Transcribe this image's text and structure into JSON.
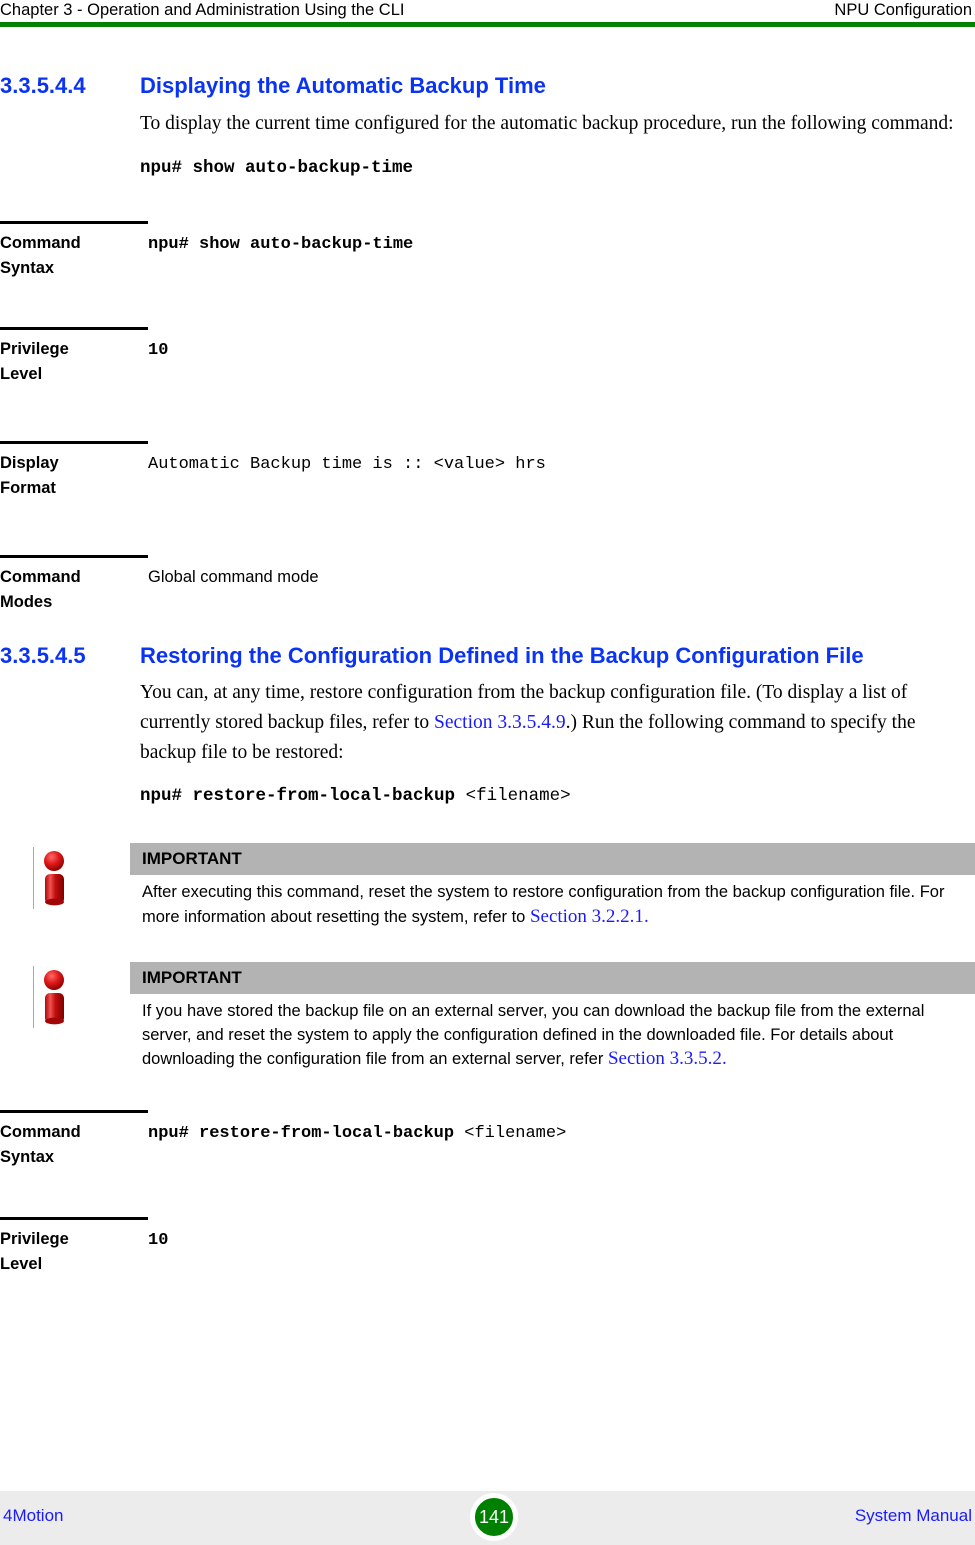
{
  "header": {
    "left": "Chapter 3 - Operation and Administration Using the CLI",
    "right": "NPU Configuration",
    "rule_color": "#008000"
  },
  "sections": [
    {
      "number": "3.3.5.4.4",
      "title": "Displaying the Automatic Backup Time",
      "paragraph": "To display the current time configured for the automatic backup procedure, run the following command:",
      "command": "npu# show auto-backup-time",
      "command_arg": ""
    },
    {
      "number": "3.3.5.4.5",
      "title": "Restoring the Configuration Defined in the Backup Configuration File",
      "paragraph_part1": "You can, at any time, restore configuration from the backup configuration file. (To display a list of currently stored backup files, refer to ",
      "paragraph_xref": "Section 3.3.5.4.9",
      "paragraph_part2": ".) Run the following command to specify the backup file to be restored:",
      "command": "npu# restore-from-local-backup",
      "command_arg": "<filename>"
    }
  ],
  "table_one": {
    "rows": [
      {
        "label_line1": "Command",
        "label_line2": "Syntax",
        "value": "npu# show auto-backup-time",
        "value_style": "mono-bold"
      },
      {
        "label_line1": "Privilege",
        "label_line2": "Level",
        "value": "10",
        "value_style": "mono-bold"
      },
      {
        "label_line1": "Display",
        "label_line2": "Format",
        "value": "Automatic Backup time is  :: <value> hrs",
        "value_style": "mono"
      },
      {
        "label_line1": "Command",
        "label_line2": "Modes",
        "value": "Global command mode",
        "value_style": "sans"
      }
    ]
  },
  "table_two": {
    "rows": [
      {
        "label_line1": "Command",
        "label_line2": "Syntax",
        "value": "npu# restore-from-local-backup",
        "value_arg": "<filename>",
        "value_style": "mono-bold"
      },
      {
        "label_line1": "Privilege",
        "label_line2": "Level",
        "value": "10",
        "value_arg": "",
        "value_style": "mono-bold"
      }
    ]
  },
  "callouts": [
    {
      "icon": "important-info-icon",
      "title": "IMPORTANT",
      "text_part1": "After executing this command, reset the system to restore configuration from the backup configuration file. For more information about resetting the system, refer to ",
      "text_xref": "Section 3.2.2.1",
      "text_part2": "."
    },
    {
      "icon": "important-info-icon",
      "title": "IMPORTANT",
      "text_part1": "If you have stored the backup file on an external server, you can download the backup file from the external server, and reset the system to apply the configuration defined in the downloaded file. For details about downloading the configuration file from an external server, refer ",
      "text_xref": "Section 3.3.5.2",
      "text_part2": "."
    }
  ],
  "footer": {
    "left": "4Motion",
    "page_number": "141",
    "right": "System Manual",
    "badge_color": "#008000",
    "band_color": "#ececec",
    "link_color": "#1a1aff"
  }
}
